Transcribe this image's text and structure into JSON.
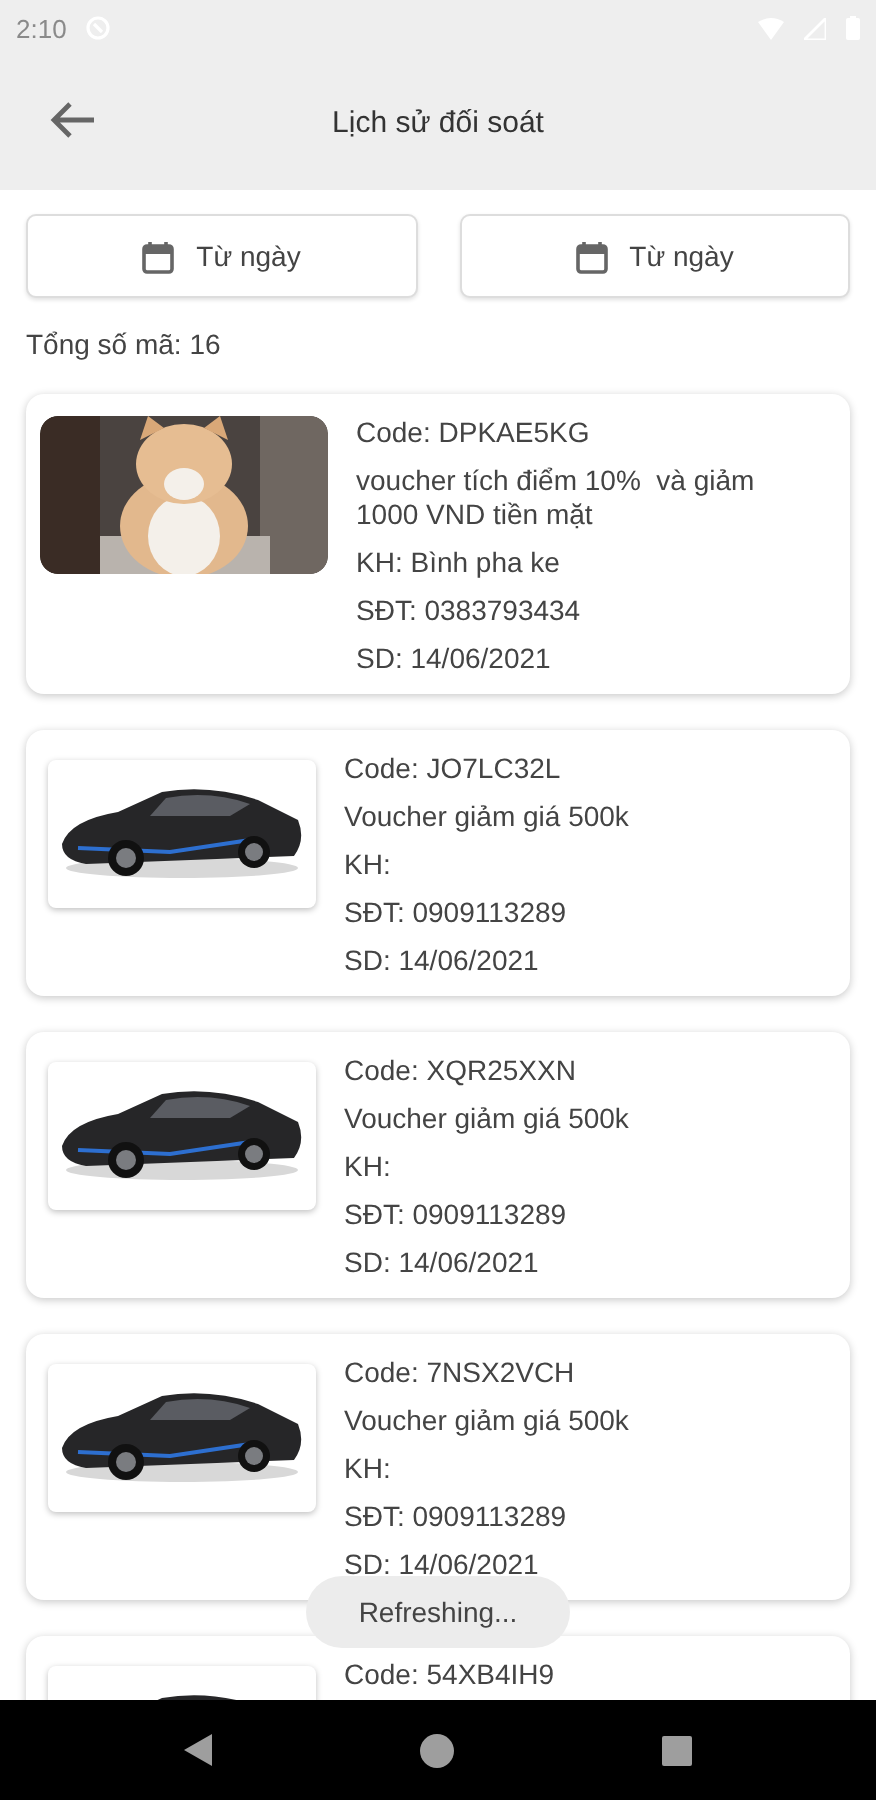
{
  "status_bar": {
    "time": "2:10"
  },
  "app_bar": {
    "title": "Lịch sử đối soát"
  },
  "filters": [
    {
      "label": "Từ ngày"
    },
    {
      "label": "Từ ngày"
    }
  ],
  "total": "Tổng số mã: 16",
  "vouchers": [
    {
      "framed": false,
      "code": "Code: DPKAE5KG",
      "description": "voucher tích điểm 10%  và giảm 1000 VND tiền mặt",
      "customer": "KH: Bình pha ke",
      "phone": "SĐT: 0383793434",
      "date": "SD: 14/06/2021"
    },
    {
      "framed": true,
      "code": "Code: JO7LC32L",
      "description": "Voucher giảm giá 500k",
      "customer": "KH:",
      "phone": "SĐT: 0909113289",
      "date": "SD: 14/06/2021"
    },
    {
      "framed": true,
      "code": "Code: XQR25XXN",
      "description": "Voucher giảm giá 500k",
      "customer": "KH:",
      "phone": "SĐT: 0909113289",
      "date": "SD: 14/06/2021"
    },
    {
      "framed": true,
      "code": "Code: 7NSX2VCH",
      "description": "Voucher giảm giá 500k",
      "customer": "KH:",
      "phone": "SĐT: 0909113289",
      "date": "SD: 14/06/2021"
    },
    {
      "framed": true,
      "code": "Code: 54XB4IH9"
    }
  ],
  "toast": {
    "message": "Refreshing..."
  }
}
